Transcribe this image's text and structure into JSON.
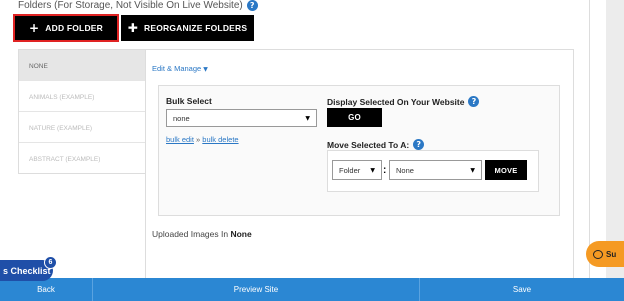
{
  "header": {
    "title": "Folders (For Storage, Not Visible On Live Website)"
  },
  "toolbar": {
    "add_folder_label": "ADD FOLDER",
    "reorganize_label": "REORGANIZE FOLDERS"
  },
  "folders": [
    {
      "label": "NONE",
      "active": true
    },
    {
      "label": "ANIMALS (EXAMPLE)",
      "active": false
    },
    {
      "label": "NATURE (EXAMPLE)",
      "active": false
    },
    {
      "label": "ABSTRACT (EXAMPLE)",
      "active": false
    }
  ],
  "manage": {
    "edit_manage_label": "Edit & Manage",
    "bulk_select_label": "Bulk Select",
    "bulk_select_value": "none",
    "bulk_edit_link": "bulk edit",
    "bulk_separator": "»",
    "bulk_delete_link": "bulk delete",
    "display_selected_label": "Display Selected On Your Website",
    "go_label": "GO",
    "move_selected_label": "Move Selected To A:",
    "move_type_value": "Folder",
    "move_target_value": "None",
    "move_label": "MOVE"
  },
  "uploaded": {
    "prefix": "Uploaded Images In",
    "folder": "None"
  },
  "footer": {
    "back_label": "Back",
    "preview_label": "Preview Site",
    "save_label": "Save"
  },
  "checklist": {
    "label": "s Checklist",
    "count": "6"
  },
  "support": {
    "label": "Su"
  },
  "colors": {
    "accent": "#2b78c5",
    "footer": "#2b87d3",
    "highlight_outline": "#e02323",
    "support": "#f59a23",
    "checklist": "#1f4fa8"
  }
}
